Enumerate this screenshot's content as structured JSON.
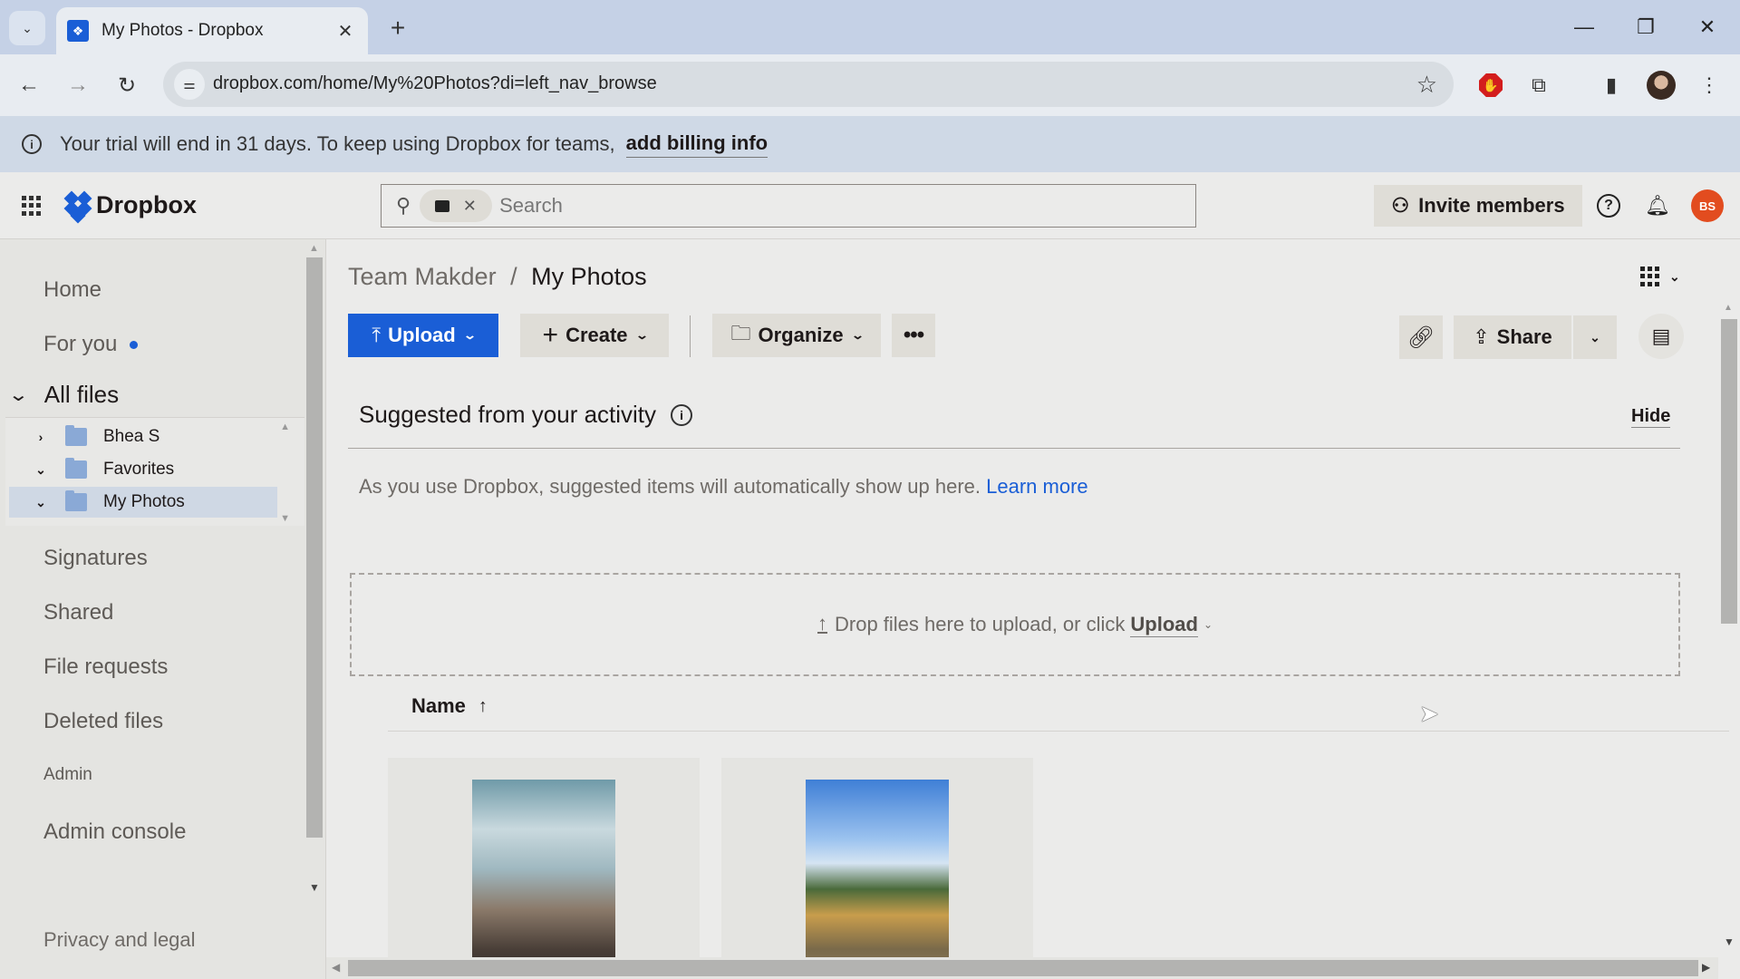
{
  "browser": {
    "tab_title": "My Photos - Dropbox",
    "url": "dropbox.com/home/My%20Photos?di=left_nav_browse",
    "icons": {
      "tab_search": "chevron-down-icon",
      "tab_close": "close-icon",
      "new_tab": "plus-icon",
      "minimize": "minimize-icon",
      "restore": "restore-icon",
      "close_window": "close-icon",
      "back": "arrow-left-icon",
      "forward": "arrow-right-icon",
      "reload": "reload-icon",
      "site_info": "tune-icon",
      "bookmark": "star-icon",
      "adblock": "adblock-icon",
      "extensions": "puzzle-icon",
      "side_panel": "side-panel-icon",
      "profile": "profile-avatar",
      "menu": "kebab-menu-icon"
    },
    "glyphs": {
      "tab_search": "⌄",
      "tab_close": "✕",
      "new_tab": "+",
      "minimize": "—",
      "restore": "❐",
      "close_window": "✕",
      "back": "←",
      "forward": "→",
      "reload": "↻",
      "site_info": "⚌",
      "bookmark": "☆",
      "adblock": "✋",
      "extensions": "⧉",
      "side_panel": "▮",
      "menu": "⋮",
      "favicon": "❖"
    }
  },
  "banner": {
    "text": "Your trial will end in 31 days. To keep using Dropbox for teams,",
    "link": "add billing info",
    "info_glyph": "i"
  },
  "header": {
    "logo_text": "Dropbox",
    "search_placeholder": "Search",
    "search_glyph": "⚲",
    "chip_close_glyph": "✕",
    "invite_label": "Invite members",
    "invite_glyph": "⚇",
    "help_glyph": "?",
    "bell_glyph": "🔔︎",
    "avatar_initials": "BS",
    "avatar_color": "#e24c1f"
  },
  "sidebar": {
    "items": [
      {
        "label": "Home"
      },
      {
        "label": "For you"
      },
      {
        "label": "All files"
      },
      {
        "label": "Signatures"
      },
      {
        "label": "Shared"
      },
      {
        "label": "File requests"
      },
      {
        "label": "Deleted files"
      },
      {
        "label": "Admin console"
      }
    ],
    "tree": [
      {
        "label": "Bhea S",
        "chevron": "›",
        "expanded": false
      },
      {
        "label": "Favorites",
        "chevron": "⌄",
        "expanded": true
      },
      {
        "label": "My Photos",
        "chevron": "⌄",
        "expanded": true,
        "selected": true
      }
    ],
    "admin_section_label": "Admin",
    "footer_link": "Privacy and legal",
    "all_files_chevron": "⌄",
    "scroll_up": "▲",
    "scroll_down": "▼"
  },
  "main": {
    "breadcrumb": {
      "parent": "Team Makder",
      "separator": "/",
      "current": "My Photos"
    },
    "toolbar": {
      "upload_label": "Upload",
      "upload_glyph": "⤒",
      "create_label": "Create",
      "create_glyph": "+",
      "organize_label": "Organize",
      "organize_glyph": "🗀",
      "more_glyph": "•••",
      "link_glyph": "🔗︎",
      "share_label": "Share",
      "share_glyph": "⇪",
      "chevron_glyph": "⌄",
      "activity_glyph": "▤"
    },
    "suggested": {
      "title": "Suggested from your activity",
      "hide_label": "Hide",
      "empty_text": "As you use Dropbox, suggested items will automatically show up here.",
      "learn_more": "Learn more"
    },
    "drop_zone": {
      "text": "Drop files here to upload, or click",
      "upload_link": "Upload",
      "glyph": "↑"
    },
    "list_header": {
      "name_label": "Name",
      "sort_glyph": "↑"
    },
    "photos": [
      {
        "alt": "street with palm trees"
      },
      {
        "alt": "golden pavilion temple"
      }
    ],
    "accent_color": "#1a5ed6"
  }
}
